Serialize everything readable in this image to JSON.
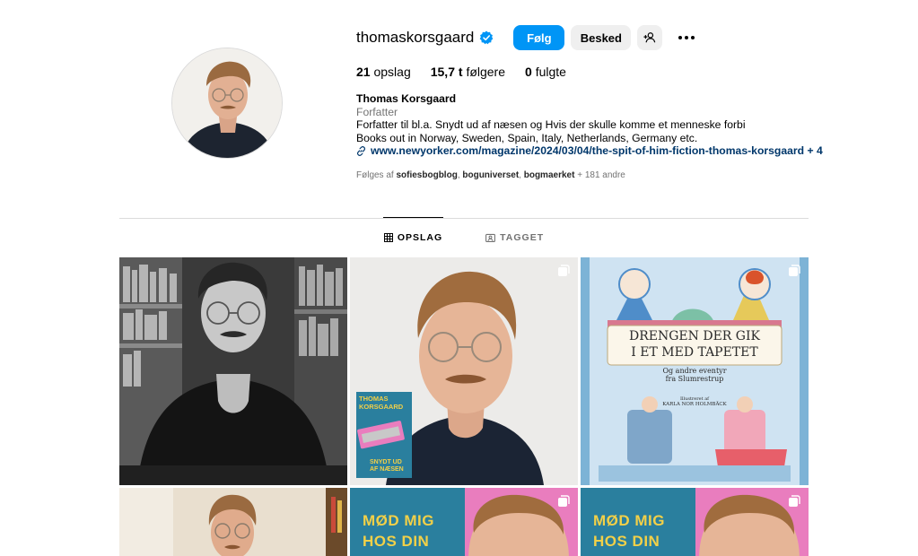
{
  "profile": {
    "username": "thomaskorsgaard",
    "verified": true,
    "follow_label": "Følg",
    "message_label": "Besked",
    "stats": {
      "posts_count": "21",
      "posts_label": "opslag",
      "followers_count": "15,7 t",
      "followers_label": "følgere",
      "following_count": "0",
      "following_label": "fulgte"
    },
    "full_name": "Thomas Korsgaard",
    "category": "Forfatter",
    "bio_line1": "Forfatter til bl.a. Snydt ud af næsen og Hvis der skulle komme et menneske forbi",
    "bio_line2": "Books out in Norway, Sweden, Spain, Italy, Netherlands, Germany etc.",
    "link": "www.newyorker.com/magazine/2024/03/04/the-spit-of-him-fiction-thomas-korsgaard + 4",
    "followed_by_prefix": "Følges af",
    "followed_by_1": "sofiesbogblog",
    "followed_by_2": "boguniverset",
    "followed_by_3": "bogmaerket",
    "followed_by_suffix": "+ 181 andre"
  },
  "tabs": {
    "posts": "OPSLAG",
    "tagged": "TAGGET"
  },
  "posts": {
    "post2_book_author": "THOMAS KORSGAARD",
    "post2_book_title": "SNYDT UD AF NÆSEN",
    "post3_title_line1": "DRENGEN DER GIK",
    "post3_title_line2": "I ET MED TAPETET",
    "post3_subtitle_line1": "Og andre eventyr",
    "post3_subtitle_line2": "fra Slumrestrup",
    "post3_illustrator_prefix": "Illustreret af",
    "post3_illustrator": "KARLA NOR HOLMBÄCK",
    "post5_text_line1": "MØD MIG",
    "post5_text_line2": "HOS DIN",
    "post6_text_line1": "MØD MIG",
    "post6_text_line2": "HOS DIN"
  },
  "icons": {
    "verified": "verified-badge-icon",
    "add_user": "add-user-icon",
    "more": "more-options-icon",
    "link": "link-icon",
    "grid": "grid-icon",
    "tagged": "tagged-icon",
    "multi": "multiple-photos-icon"
  },
  "colors": {
    "accent": "#0095f6",
    "link": "#00376b",
    "muted": "#737373",
    "button_bg": "#efefef",
    "teal_tile": "#2a7f9e",
    "pink_tile": "#e97dbe",
    "book_yellow": "#f2d048"
  }
}
